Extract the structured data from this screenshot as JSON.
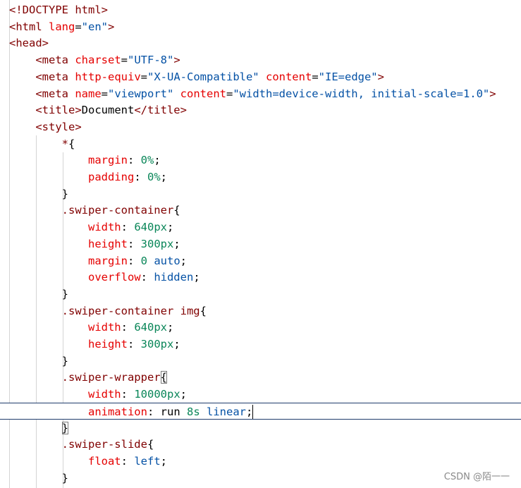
{
  "code_lines": [
    [
      {
        "t": "<!DOCTYPE html>",
        "c": "t-tag"
      }
    ],
    [
      {
        "t": "<html ",
        "c": "t-tag"
      },
      {
        "t": "lang",
        "c": "t-attr"
      },
      {
        "t": "=",
        "c": "t-plain"
      },
      {
        "t": "\"en\"",
        "c": "t-str"
      },
      {
        "t": ">",
        "c": "t-tag"
      }
    ],
    [
      {
        "t": "<head>",
        "c": "t-tag"
      }
    ],
    [
      {
        "t": "    "
      },
      {
        "t": "<meta ",
        "c": "t-tag"
      },
      {
        "t": "charset",
        "c": "t-attr"
      },
      {
        "t": "=",
        "c": "t-plain"
      },
      {
        "t": "\"UTF-8\"",
        "c": "t-str"
      },
      {
        "t": ">",
        "c": "t-tag"
      }
    ],
    [
      {
        "t": "    "
      },
      {
        "t": "<meta ",
        "c": "t-tag"
      },
      {
        "t": "http-equiv",
        "c": "t-attr"
      },
      {
        "t": "=",
        "c": "t-plain"
      },
      {
        "t": "\"X-UA-Compatible\" ",
        "c": "t-str"
      },
      {
        "t": "content",
        "c": "t-attr"
      },
      {
        "t": "=",
        "c": "t-plain"
      },
      {
        "t": "\"IE=edge\"",
        "c": "t-str"
      },
      {
        "t": ">",
        "c": "t-tag"
      }
    ],
    [
      {
        "t": "    "
      },
      {
        "t": "<meta ",
        "c": "t-tag"
      },
      {
        "t": "name",
        "c": "t-attr"
      },
      {
        "t": "=",
        "c": "t-plain"
      },
      {
        "t": "\"viewport\" ",
        "c": "t-str"
      },
      {
        "t": "content",
        "c": "t-attr"
      },
      {
        "t": "=",
        "c": "t-plain"
      },
      {
        "t": "\"width=device-width, initial-scale=1.0\"",
        "c": "t-str"
      },
      {
        "t": ">",
        "c": "t-tag"
      }
    ],
    [
      {
        "t": "    "
      },
      {
        "t": "<title>",
        "c": "t-tag"
      },
      {
        "t": "Document",
        "c": "t-text"
      },
      {
        "t": "</title>",
        "c": "t-tag"
      }
    ],
    [
      {
        "t": "    "
      },
      {
        "t": "<style>",
        "c": "t-tag"
      }
    ],
    [
      {
        "t": "        "
      },
      {
        "t": "*",
        "c": "t-sel"
      },
      {
        "t": "{",
        "c": "t-brace"
      }
    ],
    [
      {
        "t": "            "
      },
      {
        "t": "margin",
        "c": "t-prop"
      },
      {
        "t": ": ",
        "c": "t-plain"
      },
      {
        "t": "0%",
        "c": "t-num"
      },
      {
        "t": ";",
        "c": "t-plain"
      }
    ],
    [
      {
        "t": "            "
      },
      {
        "t": "padding",
        "c": "t-prop"
      },
      {
        "t": ": ",
        "c": "t-plain"
      },
      {
        "t": "0%",
        "c": "t-num"
      },
      {
        "t": ";",
        "c": "t-plain"
      }
    ],
    [
      {
        "t": "        "
      },
      {
        "t": "}",
        "c": "t-brace"
      }
    ],
    [
      {
        "t": "        "
      },
      {
        "t": ".swiper-container",
        "c": "t-sel"
      },
      {
        "t": "{",
        "c": "t-brace"
      }
    ],
    [
      {
        "t": "            "
      },
      {
        "t": "width",
        "c": "t-prop"
      },
      {
        "t": ": ",
        "c": "t-plain"
      },
      {
        "t": "640px",
        "c": "t-num"
      },
      {
        "t": ";",
        "c": "t-plain"
      }
    ],
    [
      {
        "t": "            "
      },
      {
        "t": "height",
        "c": "t-prop"
      },
      {
        "t": ": ",
        "c": "t-plain"
      },
      {
        "t": "300px",
        "c": "t-num"
      },
      {
        "t": ";",
        "c": "t-plain"
      }
    ],
    [
      {
        "t": "            "
      },
      {
        "t": "margin",
        "c": "t-prop"
      },
      {
        "t": ": ",
        "c": "t-plain"
      },
      {
        "t": "0",
        "c": "t-num"
      },
      {
        "t": " auto",
        "c": "t-val"
      },
      {
        "t": ";",
        "c": "t-plain"
      }
    ],
    [
      {
        "t": "            "
      },
      {
        "t": "overflow",
        "c": "t-prop"
      },
      {
        "t": ": ",
        "c": "t-plain"
      },
      {
        "t": "hidden",
        "c": "t-val"
      },
      {
        "t": ";",
        "c": "t-plain"
      }
    ],
    [
      {
        "t": "        "
      },
      {
        "t": "}",
        "c": "t-brace"
      }
    ],
    [
      {
        "t": "        "
      },
      {
        "t": ".swiper-container img",
        "c": "t-sel"
      },
      {
        "t": "{",
        "c": "t-brace"
      }
    ],
    [
      {
        "t": "            "
      },
      {
        "t": "width",
        "c": "t-prop"
      },
      {
        "t": ": ",
        "c": "t-plain"
      },
      {
        "t": "640px",
        "c": "t-num"
      },
      {
        "t": ";",
        "c": "t-plain"
      }
    ],
    [
      {
        "t": "            "
      },
      {
        "t": "height",
        "c": "t-prop"
      },
      {
        "t": ": ",
        "c": "t-plain"
      },
      {
        "t": "300px",
        "c": "t-num"
      },
      {
        "t": ";",
        "c": "t-plain"
      }
    ],
    [
      {
        "t": "        "
      },
      {
        "t": "}",
        "c": "t-brace"
      }
    ],
    [
      {
        "t": "        "
      },
      {
        "t": ".swiper-wrapper",
        "c": "t-sel"
      },
      {
        "t": "{",
        "c": "t-brace-box"
      }
    ],
    [
      {
        "t": "            "
      },
      {
        "t": "width",
        "c": "t-prop"
      },
      {
        "t": ": ",
        "c": "t-plain"
      },
      {
        "t": "10000px",
        "c": "t-num"
      },
      {
        "t": ";",
        "c": "t-plain"
      }
    ],
    [
      {
        "t": "            "
      },
      {
        "t": "animation",
        "c": "t-prop"
      },
      {
        "t": ": ",
        "c": "t-plain"
      },
      {
        "t": "run ",
        "c": "t-plain"
      },
      {
        "t": "8s",
        "c": "t-num"
      },
      {
        "t": " linear",
        "c": "t-val"
      },
      {
        "t": ";",
        "c": "t-plain"
      },
      {
        "cursor": true
      }
    ],
    [
      {
        "t": "        "
      },
      {
        "t": "}",
        "c": "t-brace-box"
      }
    ],
    [
      {
        "t": "        "
      },
      {
        "t": ".swiper-slide",
        "c": "t-sel"
      },
      {
        "t": "{",
        "c": "t-brace"
      }
    ],
    [
      {
        "t": "            "
      },
      {
        "t": "float",
        "c": "t-prop"
      },
      {
        "t": ": ",
        "c": "t-plain"
      },
      {
        "t": "left",
        "c": "t-val"
      },
      {
        "t": ";",
        "c": "t-plain"
      }
    ],
    [
      {
        "t": "        "
      },
      {
        "t": "}",
        "c": "t-brace"
      }
    ]
  ],
  "current_line_index": 24,
  "watermark": "CSDN @陌一一"
}
